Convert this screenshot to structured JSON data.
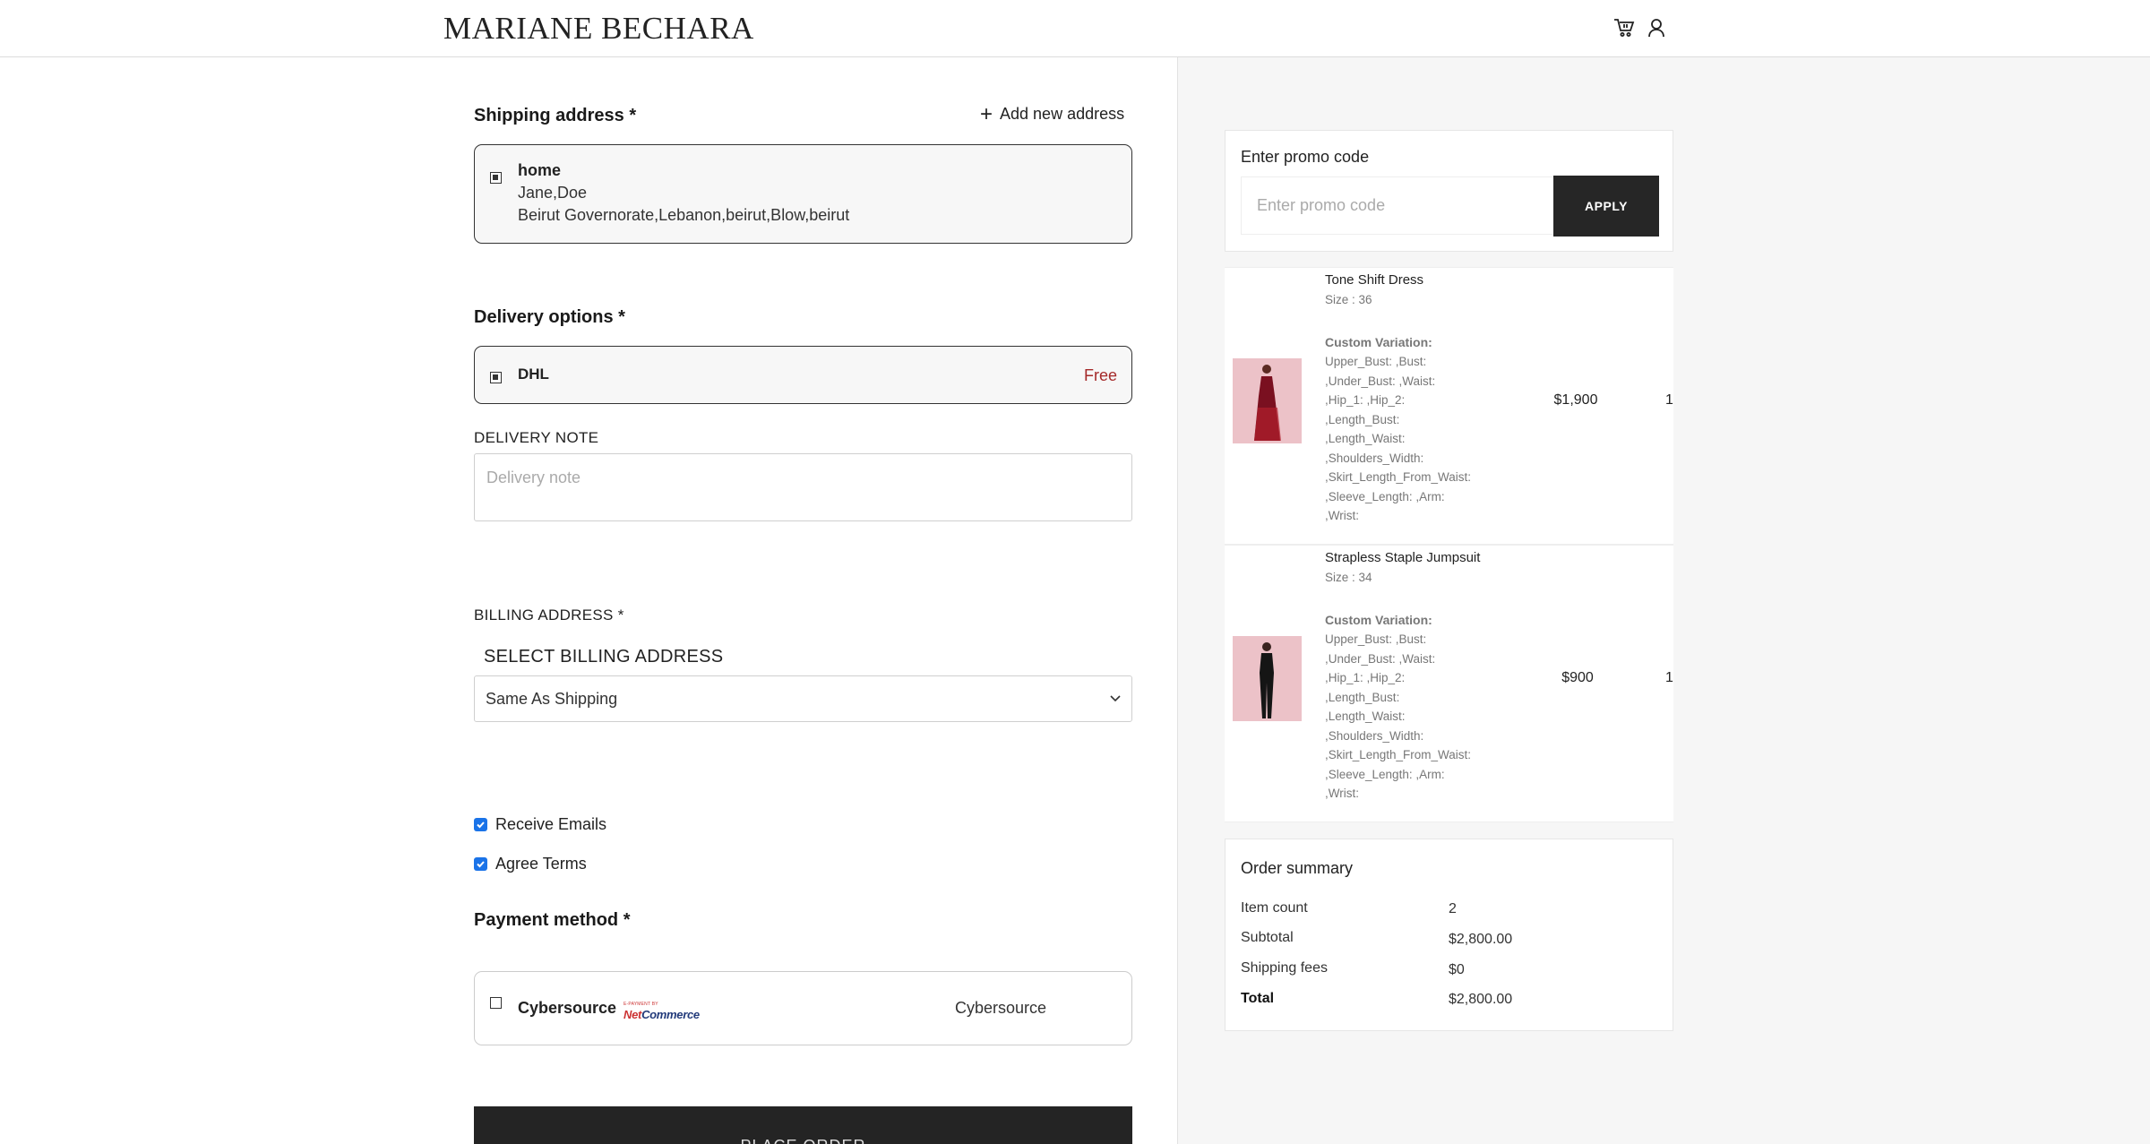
{
  "header": {
    "logo": "MARIANE BECHARA",
    "icons": [
      "cart-icon",
      "user-icon"
    ]
  },
  "shipping": {
    "title": "Shipping address *",
    "add_new": "Add new address",
    "address": {
      "label": "home",
      "name": "Jane,Doe",
      "line": "Beirut Governorate,Lebanon,beirut,Blow,beirut"
    }
  },
  "delivery": {
    "title": "Delivery options *",
    "option": {
      "name": "DHL",
      "price": "Free"
    },
    "note_label": "DELIVERY NOTE",
    "note_placeholder": "Delivery note"
  },
  "billing": {
    "title": "BILLING ADDRESS *",
    "select_label": "SELECT BILLING ADDRESS",
    "selected": "Same As Shipping"
  },
  "checks": {
    "receive_emails": "Receive Emails",
    "agree_terms": "Agree Terms"
  },
  "payment": {
    "title": "Payment method *",
    "method": "Cybersource",
    "logo_small": "E-PAYMENT BY",
    "logo_brand_a": "Net",
    "logo_brand_b": "Commerce",
    "right_label": "Cybersource"
  },
  "place_order": "PLACE ORDER",
  "promo": {
    "title": "Enter promo code",
    "placeholder": "Enter promo code",
    "apply": "APPLY"
  },
  "products": [
    {
      "name": "Tone Shift Dress",
      "size": "Size : 36",
      "variation_title": "Custom Variation:",
      "variation_lines": [
        "Upper_Bust: ,Bust:",
        ",Under_Bust: ,Waist:",
        ",Hip_1: ,Hip_2:",
        ",Length_Bust:",
        ",Length_Waist:",
        ",Shoulders_Width:",
        ",Skirt_Length_From_Waist:",
        ",Sleeve_Length: ,Arm:",
        ",Wrist:"
      ],
      "price": "$1,900",
      "qty": "1"
    },
    {
      "name": "Strapless Staple Jumpsuit",
      "size": "Size : 34",
      "variation_title": "Custom Variation:",
      "variation_lines": [
        "Upper_Bust: ,Bust:",
        ",Under_Bust: ,Waist:",
        ",Hip_1: ,Hip_2:",
        ",Length_Bust:",
        ",Length_Waist:",
        ",Shoulders_Width:",
        ",Skirt_Length_From_Waist:",
        ",Sleeve_Length: ,Arm:",
        ",Wrist:"
      ],
      "price": "$900",
      "qty": "1"
    }
  ],
  "summary": {
    "title": "Order summary",
    "rows": [
      {
        "label": "Item count",
        "value": "2"
      },
      {
        "label": "Subtotal",
        "value": "$2,800.00"
      },
      {
        "label": "Shipping fees",
        "value": "$0"
      },
      {
        "label": "Total",
        "value": "$2,800.00"
      }
    ]
  },
  "colors": {
    "dark": "#242424",
    "free_price": "#a52a2a",
    "checkbox": "#1a73e8",
    "panel_bg": "#f6f6f6"
  }
}
